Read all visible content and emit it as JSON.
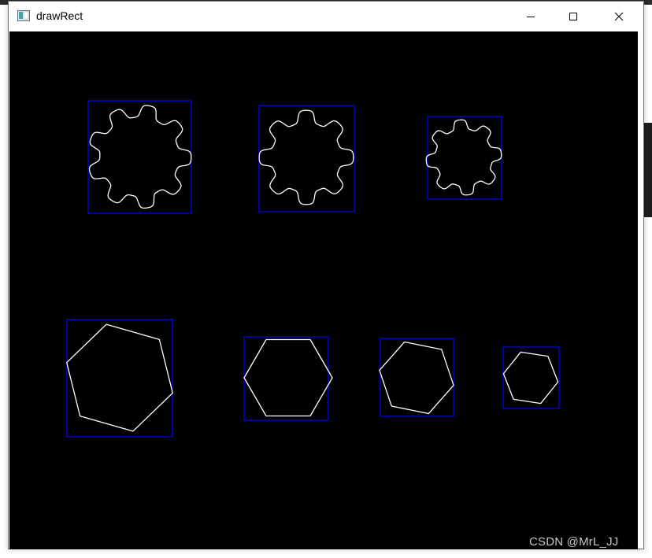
{
  "window": {
    "title": "drawRect",
    "icon": "app-window-icon",
    "controls": [
      "minimize-icon",
      "maximize-icon",
      "close-icon"
    ]
  },
  "canvas": {
    "background": "#000000",
    "box_color": "#0000ff",
    "contour_color": "#ffffff",
    "shapes": [
      {
        "kind": "gear",
        "teeth": 9
      },
      {
        "kind": "gear",
        "teeth": 8
      },
      {
        "kind": "gear",
        "teeth": 8
      },
      {
        "kind": "hexagon"
      },
      {
        "kind": "hexagon"
      },
      {
        "kind": "hexagon"
      },
      {
        "kind": "hexagon"
      }
    ]
  },
  "watermark": "CSDN @MrL_JJ"
}
